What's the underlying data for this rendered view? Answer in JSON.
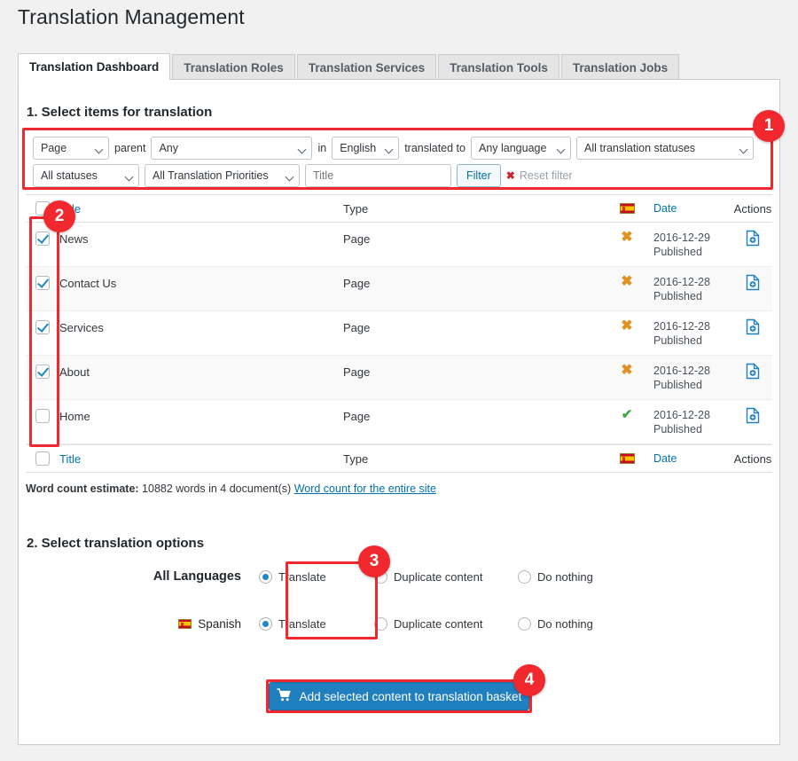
{
  "page": {
    "title": "Translation Management"
  },
  "tabs": [
    {
      "label": "Translation Dashboard",
      "active": true
    },
    {
      "label": "Translation Roles",
      "active": false
    },
    {
      "label": "Translation Services",
      "active": false
    },
    {
      "label": "Translation Tools",
      "active": false
    },
    {
      "label": "Translation Jobs",
      "active": false
    }
  ],
  "section1": {
    "title": "1. Select items for translation",
    "filters": {
      "post_type": "Page",
      "parent_label": "parent",
      "parent": "Any",
      "in_label": "in",
      "source_language": "English",
      "translated_to_label": "translated to",
      "target_language": "Any language",
      "translation_status": "All translation statuses",
      "status": "All statuses",
      "priority": "All Translation Priorities",
      "title_placeholder": "Title",
      "title_value": "",
      "filter_button": "Filter",
      "reset_filter": "Reset filter",
      "reset_icon": "x-close-icon"
    }
  },
  "table": {
    "columns": {
      "title": "Title",
      "type": "Type",
      "language_flag": "spanish-flag-icon",
      "date": "Date",
      "actions": "Actions"
    },
    "rows": [
      {
        "checked": true,
        "title": "News",
        "type": "Page",
        "translated": false,
        "date": "2016-12-29",
        "status": "Published",
        "action_icon": "add-document-icon"
      },
      {
        "checked": true,
        "title": "Contact Us",
        "type": "Page",
        "translated": false,
        "date": "2016-12-28",
        "status": "Published",
        "action_icon": "add-document-icon"
      },
      {
        "checked": true,
        "title": "Services",
        "type": "Page",
        "translated": false,
        "date": "2016-12-28",
        "status": "Published",
        "action_icon": "add-document-icon"
      },
      {
        "checked": true,
        "title": "About",
        "type": "Page",
        "translated": false,
        "date": "2016-12-28",
        "status": "Published",
        "action_icon": "add-document-icon"
      },
      {
        "checked": false,
        "title": "Home",
        "type": "Page",
        "translated": true,
        "date": "2016-12-28",
        "status": "Published",
        "action_icon": "add-document-icon"
      }
    ],
    "select_all_checked": false
  },
  "word_count": {
    "label": "Word count estimate:",
    "value": "10882 words in 4 document(s)",
    "link": "Word count for the entire site"
  },
  "section2": {
    "title": "2. Select translation options",
    "options": [
      {
        "language": "All Languages",
        "flag": null,
        "choices": [
          {
            "label": "Translate",
            "selected": true
          },
          {
            "label": "Duplicate content",
            "selected": false
          },
          {
            "label": "Do nothing",
            "selected": false
          }
        ]
      },
      {
        "language": "Spanish",
        "flag": "spanish-flag-icon",
        "choices": [
          {
            "label": "Translate",
            "selected": true
          },
          {
            "label": "Duplicate content",
            "selected": false
          },
          {
            "label": "Do nothing",
            "selected": false
          }
        ]
      }
    ]
  },
  "basket": {
    "label": "Add selected content to translation basket",
    "icon": "shopping-cart-icon"
  },
  "annotations": [
    {
      "number": "1"
    },
    {
      "number": "2"
    },
    {
      "number": "3"
    },
    {
      "number": "4"
    }
  ],
  "colors": {
    "accent_blue": "#1f7fbf",
    "link_blue": "#0073aa",
    "annotation_red": "#f1292e",
    "warn_orange": "#e2901f",
    "ok_green": "#46a546",
    "page_bg": "#f1f1f1"
  }
}
